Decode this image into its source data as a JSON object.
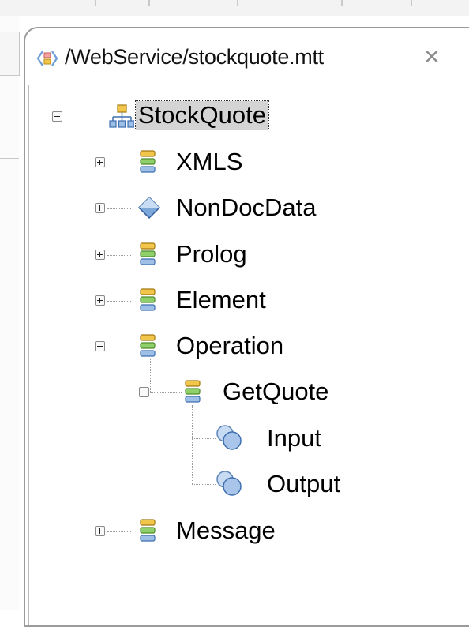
{
  "editor_tab": {
    "title": "/WebService/stockquote.mtt",
    "close_glyph": "✕",
    "icon": "service-diamond-icon"
  },
  "tree": {
    "root": {
      "label": "StockQuote",
      "expanded": true,
      "selected": true,
      "icon": "hierarchy-icon"
    },
    "items": [
      {
        "label": "XMLS",
        "expanded": false,
        "icon": "element-list-icon"
      },
      {
        "label": "NonDocData",
        "expanded": false,
        "icon": "diamond-icon"
      },
      {
        "label": "Prolog",
        "expanded": false,
        "icon": "element-list-icon"
      },
      {
        "label": "Element",
        "expanded": false,
        "icon": "element-list-icon"
      },
      {
        "label": "Operation",
        "expanded": true,
        "icon": "element-list-icon",
        "children": [
          {
            "label": "GetQuote",
            "expanded": true,
            "icon": "element-list-icon",
            "children": [
              {
                "label": "Input",
                "icon": "message-icon"
              },
              {
                "label": "Output",
                "icon": "message-icon"
              }
            ]
          }
        ]
      },
      {
        "label": "Message",
        "expanded": false,
        "icon": "element-list-icon"
      }
    ]
  },
  "colors": {
    "selection_bg": "#d4d4d4",
    "icon_gold": "#f2c64a",
    "icon_blue": "#9fc0e6",
    "icon_green": "#8fd06a",
    "frame_border": "#9b9b9b"
  }
}
